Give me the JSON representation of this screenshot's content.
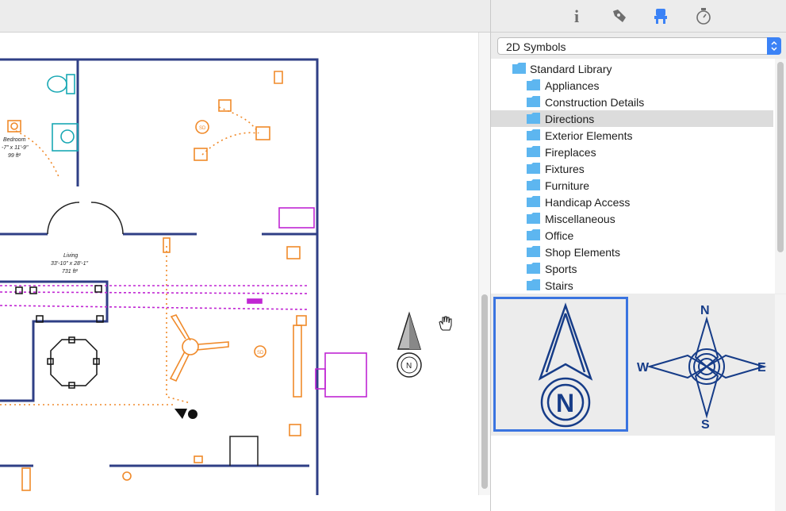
{
  "toolbar": {
    "tabs": [
      {
        "name": "info-icon",
        "glyph": "i"
      },
      {
        "name": "pen-icon",
        "glyph": ""
      },
      {
        "name": "chair-icon",
        "glyph": ""
      },
      {
        "name": "stopwatch-icon",
        "glyph": ""
      }
    ],
    "active_tab_color": "#3b82f6",
    "inactive_tab_color": "#6e6e6e"
  },
  "library": {
    "dropdown_value": "2D Symbols",
    "tree": [
      {
        "label": "Standard Library",
        "expanded": true,
        "root": true
      },
      {
        "label": "Appliances",
        "expandable": false
      },
      {
        "label": "Construction Details",
        "expandable": true
      },
      {
        "label": "Directions",
        "expandable": false,
        "selected": true
      },
      {
        "label": "Exterior Elements",
        "expandable": true
      },
      {
        "label": "Fireplaces",
        "expandable": false
      },
      {
        "label": "Fixtures",
        "expandable": false
      },
      {
        "label": "Furniture",
        "expandable": true
      },
      {
        "label": "Handicap Access",
        "expandable": false
      },
      {
        "label": "Miscellaneous",
        "expandable": false
      },
      {
        "label": "Office",
        "expandable": false
      },
      {
        "label": "Shop Elements",
        "expandable": false
      },
      {
        "label": "Sports",
        "expandable": false
      },
      {
        "label": "Stairs",
        "expandable": false
      }
    ],
    "symbols": [
      {
        "name": "north-arrow-symbol",
        "letter": "N",
        "selected": true
      },
      {
        "name": "compass-rose-symbol",
        "letters": [
          "N",
          "W",
          "E",
          "S"
        ]
      }
    ]
  },
  "plan": {
    "rooms": [
      {
        "name": "Bedroom",
        "size": "-7\" x 11'-9\"",
        "area": "99 ft²"
      },
      {
        "name": "Living",
        "size": "33'-10\" x 28'-1\"",
        "area": "731 ft²"
      }
    ],
    "outlet_labels": [
      "SD",
      "SD"
    ],
    "north_letter": "N"
  },
  "colors": {
    "wall": "#2f3f86",
    "electrical": "#f08a2a",
    "plumbing": "#19a8b4",
    "furniture": "#c026d3",
    "accent": "#3b82f6",
    "symbol_blue": "#163c88"
  }
}
